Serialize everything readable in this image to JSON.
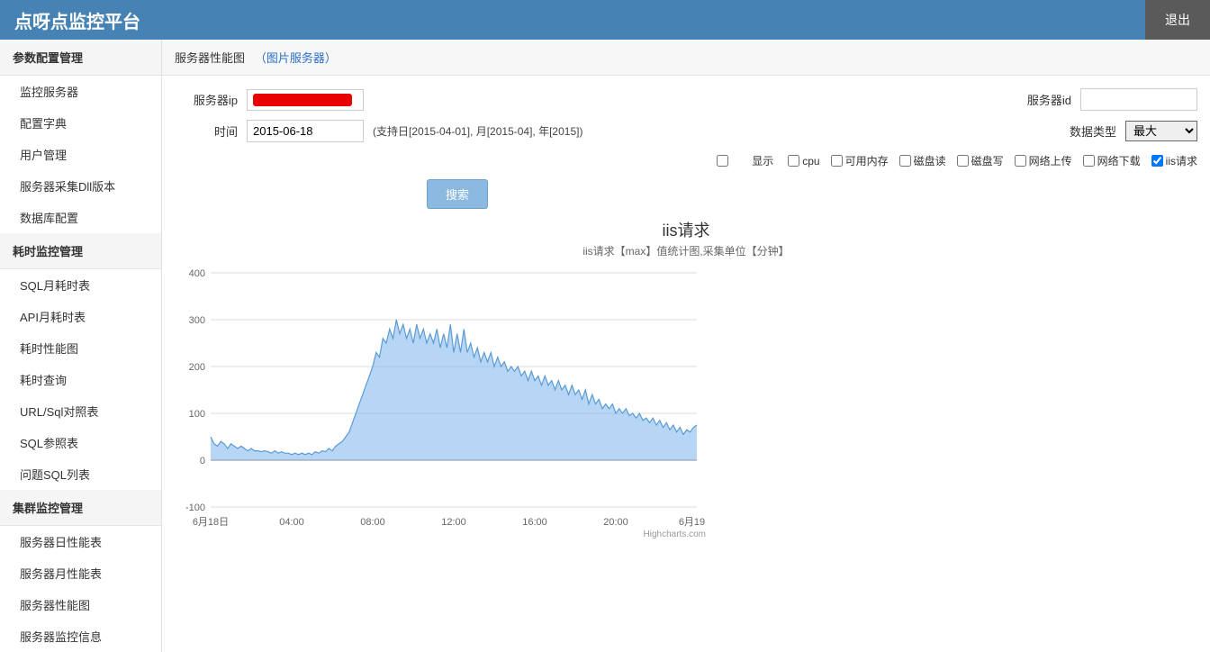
{
  "topbar": {
    "logo": "点呀点监控平台",
    "logout": "退出"
  },
  "sidebar": {
    "group1": {
      "title": "参数配置管理",
      "items": [
        "监控服务器",
        "配置字典",
        "用户管理",
        "服务器采集Dll版本",
        "数据库配置"
      ]
    },
    "group2": {
      "title": "耗时监控管理",
      "items": [
        "SQL月耗时表",
        "API月耗时表",
        "耗时性能图",
        "耗时查询",
        "URL/Sql对照表",
        "SQL参照表",
        "问题SQL列表"
      ]
    },
    "group3": {
      "title": "集群监控管理",
      "items": [
        "服务器日性能表",
        "服务器月性能表",
        "服务器性能图",
        "服务器监控信息"
      ]
    }
  },
  "breadcrumb": {
    "title": "服务器性能图",
    "link": "（图片服务器）"
  },
  "form": {
    "ip_label": "服务器ip",
    "time_label": "时间",
    "time_value": "2015-06-18",
    "time_hint": "(支持日[2015-04-01], 月[2015-04], 年[2015])",
    "id_label": "服务器id",
    "id_value": "",
    "dtype_label": "数据类型",
    "dtype_value": "最大",
    "display_label": "显示",
    "checks": {
      "cpu": "cpu",
      "mem": "可用内存",
      "dread": "磁盘读",
      "dwrite": "磁盘写",
      "netup": "网络上传",
      "netdown": "网络下载",
      "iis": "iis请求"
    },
    "search": "搜索"
  },
  "chart": {
    "title": "iis请求",
    "subtitle": "iis请求【max】值统计图,采集单位【分钟】",
    "credits": "Highcharts.com"
  },
  "chart_data": {
    "type": "area",
    "title": "iis请求",
    "xlabel": "",
    "ylabel": "",
    "ylim": [
      -100,
      400
    ],
    "x_categories": [
      "6月18日",
      "04:00",
      "08:00",
      "12:00",
      "16:00",
      "20:00",
      "6月19日"
    ],
    "x_count": 145,
    "values": [
      50,
      35,
      30,
      40,
      35,
      25,
      35,
      30,
      25,
      30,
      25,
      20,
      25,
      20,
      20,
      18,
      20,
      18,
      15,
      20,
      15,
      18,
      15,
      15,
      12,
      15,
      12,
      15,
      12,
      15,
      12,
      18,
      15,
      20,
      18,
      25,
      20,
      30,
      35,
      40,
      50,
      60,
      80,
      100,
      120,
      140,
      160,
      180,
      200,
      230,
      220,
      260,
      250,
      280,
      260,
      300,
      270,
      290,
      260,
      280,
      250,
      290,
      260,
      280,
      250,
      270,
      250,
      280,
      240,
      270,
      240,
      290,
      230,
      270,
      230,
      280,
      230,
      250,
      220,
      240,
      210,
      230,
      210,
      230,
      200,
      220,
      200,
      210,
      190,
      200,
      190,
      200,
      180,
      190,
      170,
      190,
      170,
      180,
      160,
      180,
      160,
      170,
      150,
      170,
      150,
      160,
      140,
      160,
      140,
      150,
      130,
      150,
      120,
      140,
      120,
      130,
      110,
      120,
      110,
      120,
      100,
      110,
      100,
      110,
      95,
      100,
      90,
      100,
      85,
      90,
      80,
      90,
      75,
      85,
      70,
      80,
      65,
      75,
      60,
      70,
      55,
      65,
      60,
      70,
      75
    ]
  }
}
